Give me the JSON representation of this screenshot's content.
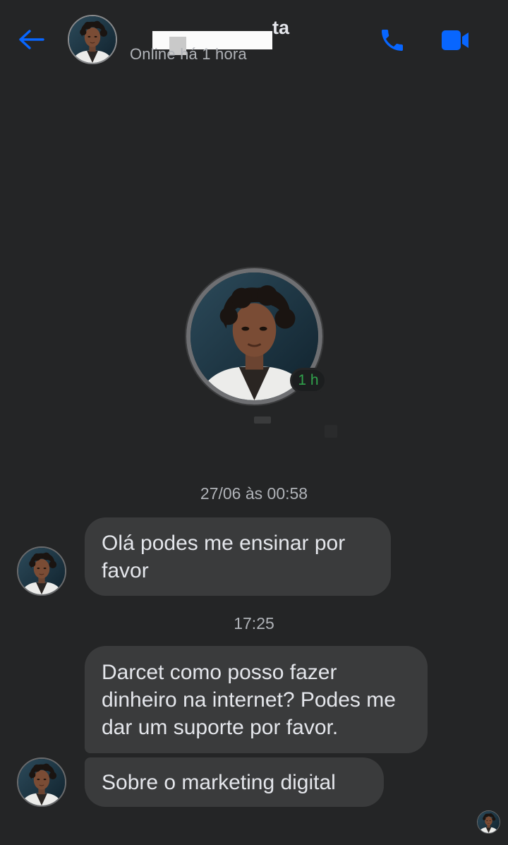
{
  "header": {
    "contact_name_visible": "ta",
    "status": "Online há 1 hora",
    "back_icon": "arrow-left-icon",
    "call_icon": "phone-icon",
    "video_icon": "video-camera-icon",
    "accent_color": "#0866ff"
  },
  "profile": {
    "active_badge": "1 h",
    "badge_color": "#31a24c"
  },
  "conversation": {
    "timestamps": [
      "27/06 às 00:58",
      "17:25"
    ],
    "messages": [
      {
        "text": "Olá podes me ensinar por favor"
      },
      {
        "text": "Darcet como posso fazer dinheiro na internet? Podes me dar um suporte por favor."
      },
      {
        "text": "Sobre o marketing digital"
      }
    ]
  },
  "colors": {
    "background": "#242526",
    "bubble": "#3a3b3c",
    "text": "#e4e6eb",
    "muted": "#b0b3b8"
  }
}
